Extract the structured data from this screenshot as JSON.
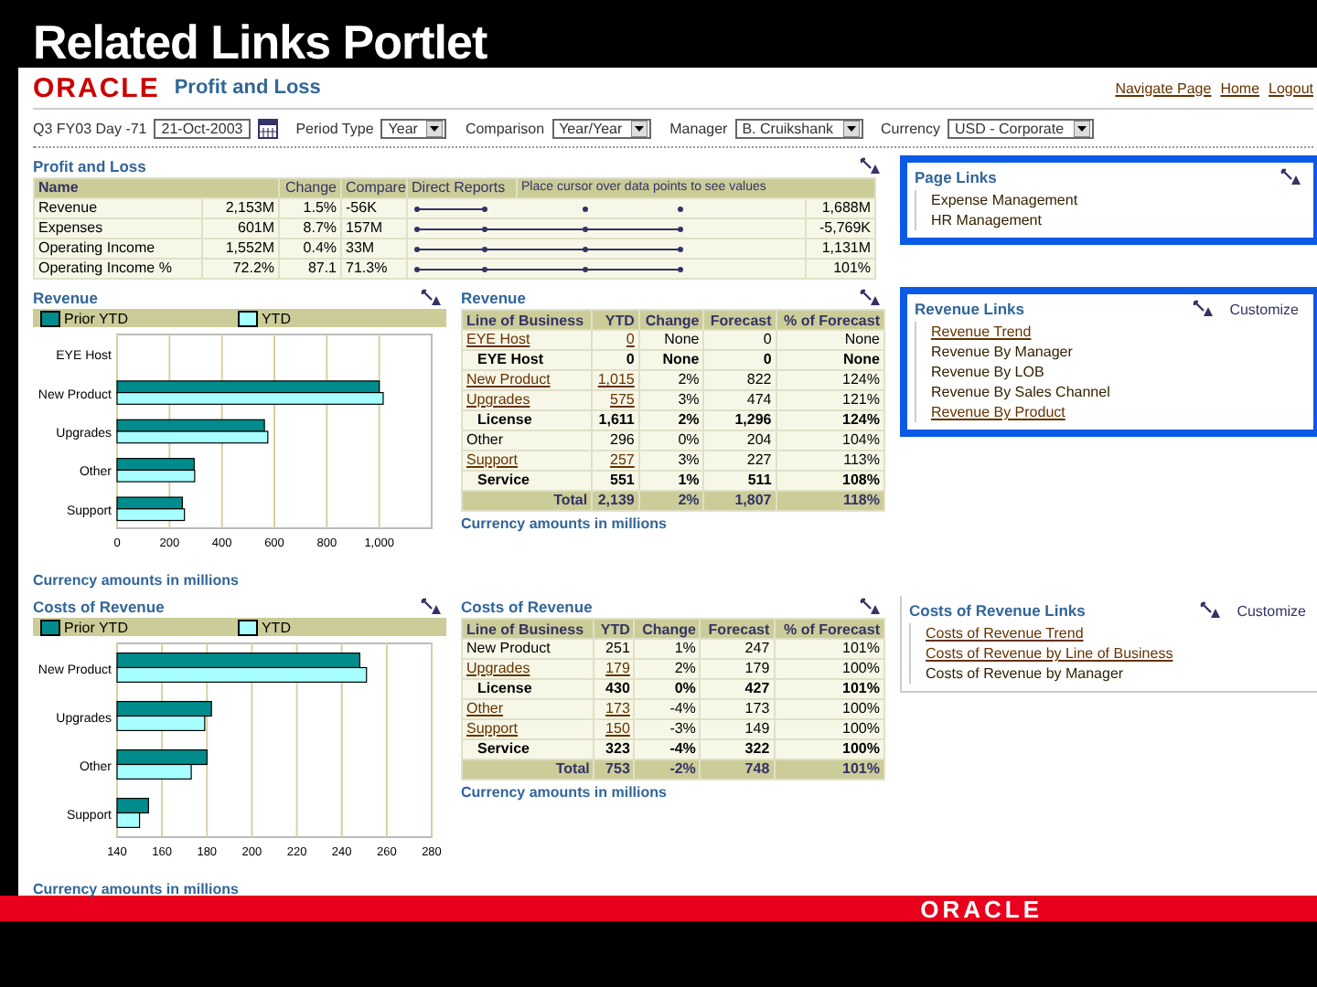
{
  "slide_title": "Related Links Portlet",
  "header": {
    "logo": "ORACLE",
    "title": "Profit and Loss",
    "links": [
      "Navigate Page",
      "Home",
      "Logout"
    ]
  },
  "params": {
    "period_label": "Q3 FY03 Day -71",
    "date": "21-Oct-2003",
    "selects": [
      {
        "label": "Period Type",
        "value": "Year"
      },
      {
        "label": "Comparison",
        "value": "Year/Year"
      },
      {
        "label": "Manager",
        "value": "B. Cruikshank"
      },
      {
        "label": "Currency",
        "value": "USD - Corporate"
      }
    ]
  },
  "pnl": {
    "title": "Profit and Loss",
    "columns": {
      "name": "Name",
      "change": "Change",
      "compare": "Compare",
      "reports": "Direct Reports",
      "hint": "Place cursor over data points to see values"
    },
    "rows": [
      {
        "name": "Revenue",
        "value": "2,153M",
        "change": "1.5%",
        "compare": "-56K",
        "end_value": "1,688M"
      },
      {
        "name": "Expenses",
        "value": "601M",
        "change": "8.7%",
        "compare": "157M",
        "end_value": "-5,769K"
      },
      {
        "name": "Operating Income",
        "value": "1,552M",
        "change": "0.4%",
        "compare": "33M",
        "end_value": "1,131M"
      },
      {
        "name": "Operating Income %",
        "value": "72.2%",
        "change": "87.1",
        "compare": "71.3%",
        "end_value": "101%"
      }
    ]
  },
  "page_links": {
    "title": "Page Links",
    "links": [
      {
        "label": "Expense Management",
        "underlined": false
      },
      {
        "label": "HR Management",
        "underlined": false
      }
    ]
  },
  "revenue_chart": {
    "title": "Revenue",
    "footnote": "Currency amounts in millions",
    "chart_data": {
      "type": "bar",
      "orientation": "horizontal",
      "categories": [
        "EYE Host",
        "New Product",
        "Upgrades",
        "Other",
        "Support"
      ],
      "series": [
        {
          "name": "Prior YTD",
          "color": "#008c8c",
          "values": [
            0,
            1000,
            562,
            294,
            249
          ]
        },
        {
          "name": "YTD",
          "color": "#a8ffff",
          "values": [
            0,
            1015,
            575,
            296,
            257
          ]
        }
      ],
      "xlim": [
        0,
        1200
      ],
      "grid": true,
      "xticks": [
        0,
        200,
        400,
        600,
        800,
        {
          "value": 1000,
          "label": "1,000"
        }
      ]
    }
  },
  "revenue_table": {
    "title": "Revenue",
    "columns": [
      "Line of Business",
      "YTD",
      "Change",
      "Forecast",
      "% of Forecast"
    ],
    "rows": [
      {
        "kind": "link",
        "cells": [
          "EYE Host",
          "0",
          "None",
          "0",
          "None"
        ]
      },
      {
        "kind": "subtotal",
        "cells": [
          "EYE Host",
          "0",
          "None",
          "0",
          "None"
        ]
      },
      {
        "kind": "link",
        "cells": [
          "New Product",
          "1,015",
          "2%",
          "822",
          "124%"
        ]
      },
      {
        "kind": "link",
        "cells": [
          "Upgrades",
          "575",
          "3%",
          "474",
          "121%"
        ]
      },
      {
        "kind": "subtotal",
        "cells": [
          "License",
          "1,611",
          "2%",
          "1,296",
          "124%"
        ]
      },
      {
        "kind": "plain",
        "cells": [
          "Other",
          "296",
          "0%",
          "204",
          "104%"
        ]
      },
      {
        "kind": "link",
        "cells": [
          "Support",
          "257",
          "3%",
          "227",
          "113%"
        ]
      },
      {
        "kind": "subtotal",
        "cells": [
          "Service",
          "551",
          "1%",
          "511",
          "108%"
        ]
      }
    ],
    "total": [
      "Total",
      "2,139",
      "2%",
      "1,807",
      "118%"
    ],
    "footnote": "Currency amounts in millions"
  },
  "revenue_links": {
    "title": "Revenue Links",
    "customize": "Customize",
    "links": [
      {
        "label": "Revenue Trend",
        "underlined": true
      },
      {
        "label": "Revenue By Manager",
        "underlined": false
      },
      {
        "label": "Revenue By LOB",
        "underlined": false
      },
      {
        "label": "Revenue By Sales Channel",
        "underlined": false
      },
      {
        "label": "Revenue By Product",
        "underlined": true
      }
    ]
  },
  "costs_chart": {
    "title": "Costs of Revenue",
    "footnote": "Currency amounts in millions",
    "chart_data": {
      "type": "bar",
      "orientation": "horizontal",
      "categories": [
        "New Product",
        "Upgrades",
        "Other",
        "Support"
      ],
      "series": [
        {
          "name": "Prior YTD",
          "color": "#008c8c",
          "values": [
            248,
            182,
            180,
            154
          ]
        },
        {
          "name": "YTD",
          "color": "#a8ffff",
          "values": [
            251,
            179,
            173,
            150
          ]
        }
      ],
      "xlim": [
        140,
        280
      ],
      "grid": true,
      "xticks": [
        140,
        160,
        180,
        200,
        220,
        240,
        260,
        280
      ]
    }
  },
  "costs_table": {
    "title": "Costs of Revenue",
    "columns": [
      "Line of Business",
      "YTD",
      "Change",
      "Forecast",
      "% of Forecast"
    ],
    "rows": [
      {
        "kind": "plain",
        "cells": [
          "New Product",
          "251",
          "1%",
          "247",
          "101%"
        ]
      },
      {
        "kind": "link",
        "cells": [
          "Upgrades",
          "179",
          "2%",
          "179",
          "100%"
        ]
      },
      {
        "kind": "subtotal",
        "cells": [
          "License",
          "430",
          "0%",
          "427",
          "101%"
        ]
      },
      {
        "kind": "link",
        "cells": [
          "Other",
          "173",
          "-4%",
          "173",
          "100%"
        ]
      },
      {
        "kind": "link",
        "cells": [
          "Support",
          "150",
          "-3%",
          "149",
          "100%"
        ]
      },
      {
        "kind": "subtotal",
        "cells": [
          "Service",
          "323",
          "-4%",
          "322",
          "100%"
        ]
      }
    ],
    "total": [
      "Total",
      "753",
      "-2%",
      "748",
      "101%"
    ],
    "footnote": "Currency amounts in millions"
  },
  "costs_links": {
    "title": "Costs of Revenue Links",
    "customize": "Customize",
    "links": [
      {
        "label": "Costs of Revenue Trend",
        "underlined": true
      },
      {
        "label": "Costs of Revenue by Line of Business",
        "underlined": true
      },
      {
        "label": "Costs of Revenue by Manager",
        "underlined": false
      }
    ]
  },
  "footer": {
    "logo": "ORACLE"
  }
}
